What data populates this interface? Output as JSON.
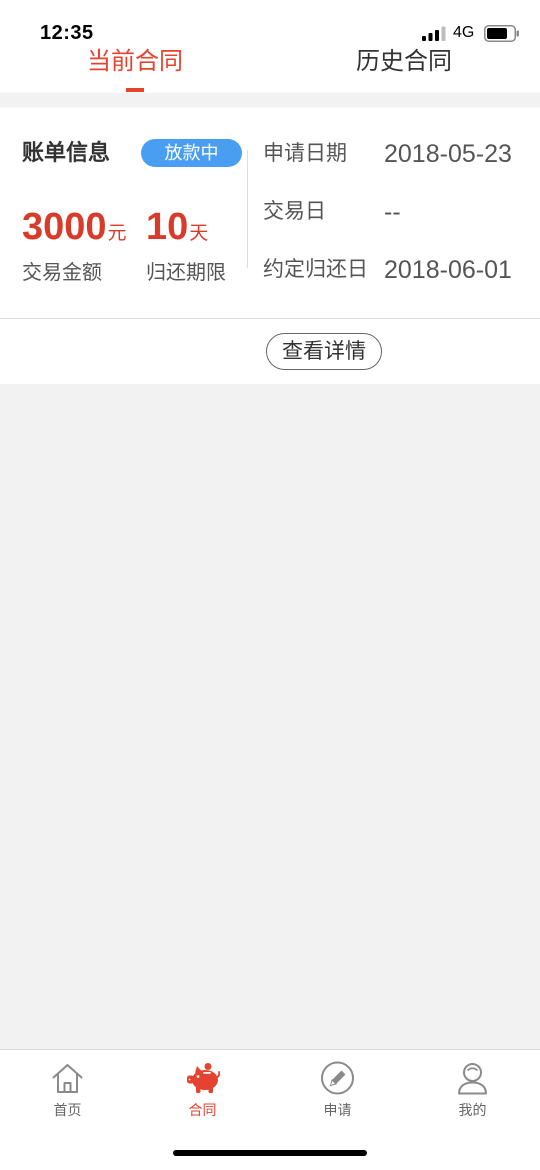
{
  "status_bar": {
    "time": "12:35",
    "network": "4G"
  },
  "tabs": [
    {
      "label": "当前合同",
      "active": true
    },
    {
      "label": "历史合同",
      "active": false
    }
  ],
  "bill": {
    "title": "账单信息",
    "status_badge": "放款中",
    "amount": {
      "value": "3000",
      "unit": "元",
      "label": "交易金额"
    },
    "term": {
      "value": "10",
      "unit": "天",
      "label": "归还期限"
    },
    "details": [
      {
        "label": "申请日期",
        "value": "2018-05-23"
      },
      {
        "label": "交易日",
        "value": "--"
      },
      {
        "label": "约定归还日",
        "value": "2018-06-01"
      }
    ],
    "detail_button": "查看详情"
  },
  "bottom_nav": [
    {
      "label": "首页",
      "icon": "home-icon",
      "active": false
    },
    {
      "label": "合同",
      "icon": "piggy-bank-icon",
      "active": true
    },
    {
      "label": "申请",
      "icon": "pencil-circle-icon",
      "active": false
    },
    {
      "label": "我的",
      "icon": "user-icon",
      "active": false
    }
  ],
  "colors": {
    "accent": "#e5432f",
    "amount": "#d93b2b",
    "badge": "#4a9ef2",
    "background": "#f2f2f2",
    "text": "#333333"
  }
}
